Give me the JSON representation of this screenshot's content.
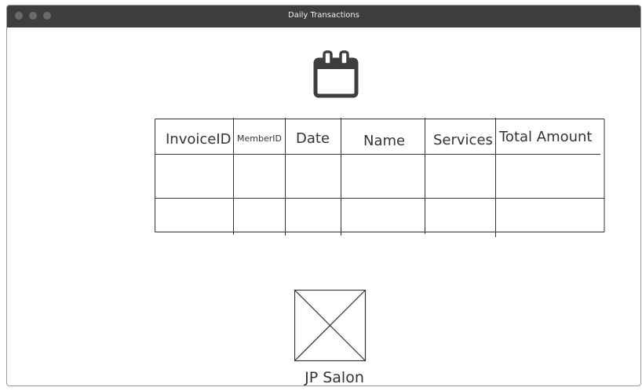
{
  "window": {
    "title": "Daily Transactions"
  },
  "icons": {
    "calendar": "calendar-icon",
    "logo_placeholder": "image-placeholder-icon"
  },
  "table": {
    "columns": [
      "InvoiceID",
      "MemberID",
      "Date",
      "Name",
      "Services",
      "Total Amount"
    ],
    "rows": [
      [
        "",
        "",
        "",
        "",
        "",
        ""
      ],
      [
        "",
        "",
        "",
        "",
        "",
        ""
      ]
    ]
  },
  "footer": {
    "salon_name": "JP Salon"
  },
  "colors": {
    "titlebar": "#3d3d3d",
    "title_text": "#f2f2f2",
    "line": "#333333",
    "icon": "#3d3d3d"
  }
}
